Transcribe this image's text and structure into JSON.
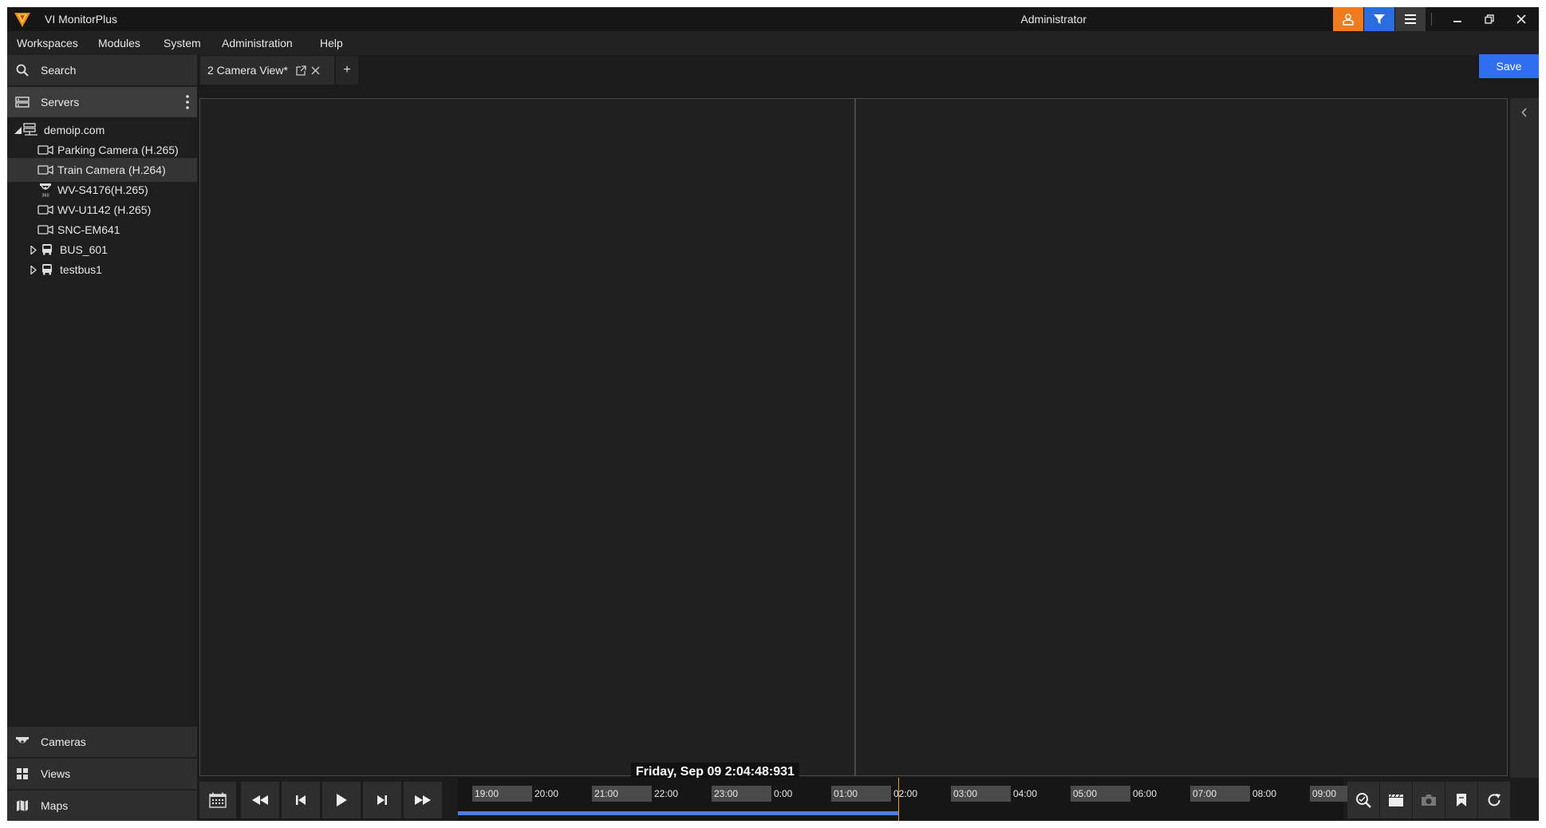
{
  "app": {
    "title": "VI MonitorPlus",
    "user": "Administrator"
  },
  "menu": [
    "Workspaces",
    "Modules",
    "System",
    "Administration",
    "Help"
  ],
  "sidebar": {
    "search_label": "Search",
    "servers_label": "Servers",
    "tree": [
      {
        "label": "demoip.com",
        "icon": "server-icon"
      },
      {
        "label": "Parking Camera (H.265)",
        "icon": "camera-icon"
      },
      {
        "label": "Train Camera (H.264)",
        "icon": "camera-icon",
        "selected": true
      },
      {
        "label": "WV-S4176(H.265)",
        "icon": "camera-360-icon"
      },
      {
        "label": "WV-U1142 (H.265)",
        "icon": "camera-icon"
      },
      {
        "label": "SNC-EM641",
        "icon": "camera-icon"
      },
      {
        "label": "BUS_601",
        "icon": "bus-icon"
      },
      {
        "label": "testbus1",
        "icon": "bus-icon"
      }
    ],
    "bottom": [
      {
        "label": "Cameras",
        "icon": "dome-camera-icon"
      },
      {
        "label": "Views",
        "icon": "grid-icon"
      },
      {
        "label": "Maps",
        "icon": "map-icon"
      }
    ]
  },
  "tabs": [
    {
      "label": "2 Camera View*"
    }
  ],
  "tab_add_label": "+",
  "save_label": "Save",
  "timestamp": "Friday, Sep 09  2:04:48:931",
  "timeline": {
    "ticks": [
      "19:00",
      "20:00",
      "21:00",
      "22:00",
      "23:00",
      "0:00",
      "01:00",
      "02:00",
      "03:00",
      "04:00",
      "05:00",
      "06:00",
      "07:00",
      "08:00",
      "09:00"
    ],
    "recorded_fraction": 0.497
  },
  "colors": {
    "accent_orange": "#f07a1d",
    "accent_blue": "#2b6cde",
    "save_blue": "#2f6ef0",
    "progress_blue": "#4f7ce0"
  }
}
